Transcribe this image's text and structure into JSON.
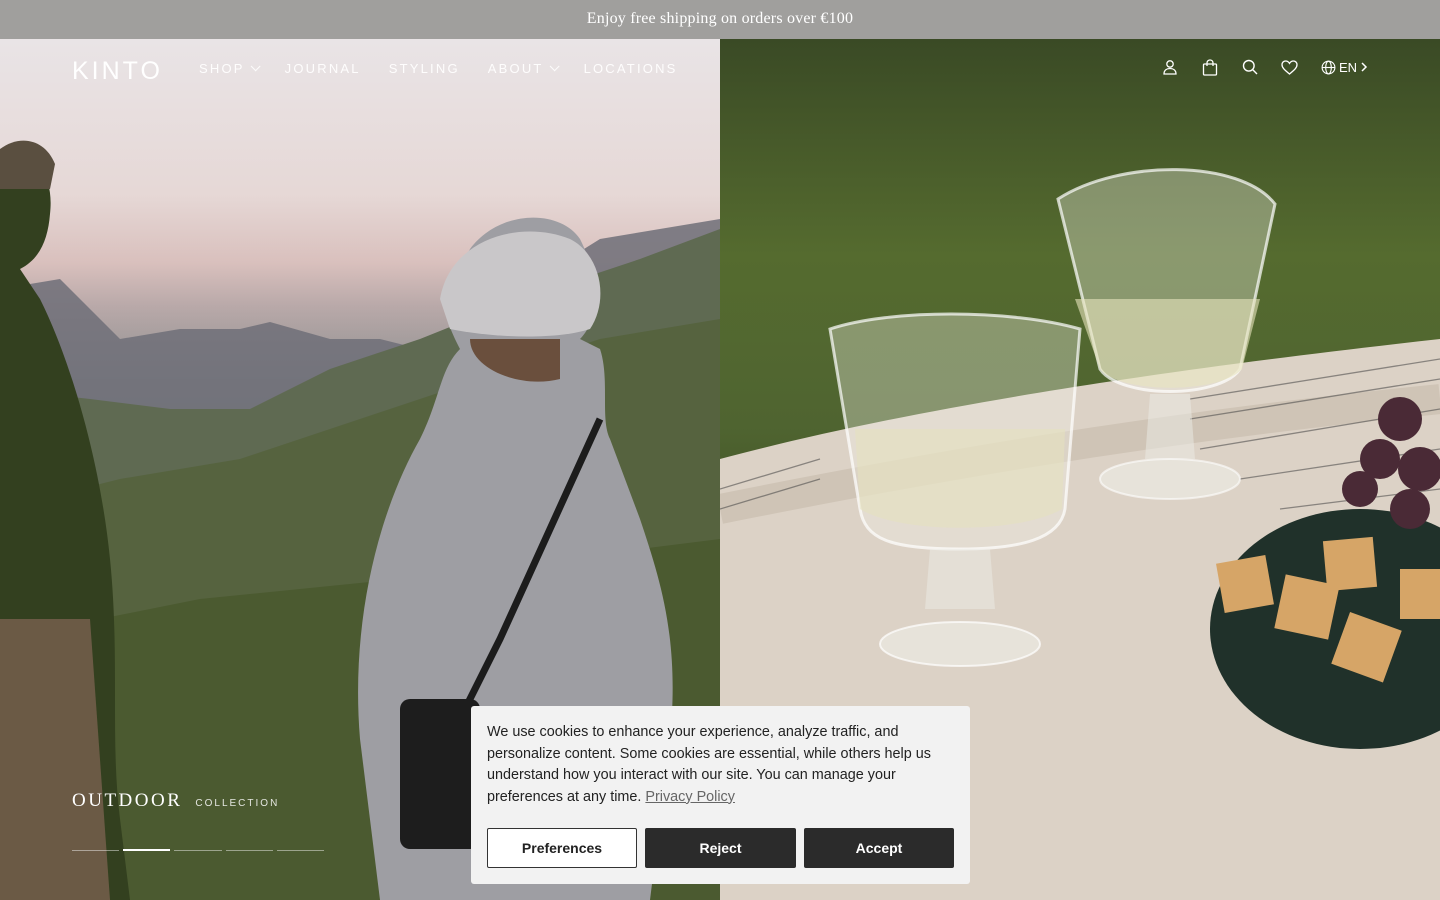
{
  "announcement": {
    "text": "Enjoy free shipping on orders over €100"
  },
  "header": {
    "logo": "KINTO",
    "menu": [
      {
        "label": "SHOP",
        "has_dropdown": true
      },
      {
        "label": "JOURNAL",
        "has_dropdown": false
      },
      {
        "label": "STYLING",
        "has_dropdown": false
      },
      {
        "label": "ABOUT",
        "has_dropdown": true
      },
      {
        "label": "LOCATIONS",
        "has_dropdown": false
      }
    ],
    "icons": [
      "account-icon",
      "bag-icon",
      "search-icon",
      "wishlist-icon",
      "globe-icon"
    ],
    "language": "EN"
  },
  "hero": {
    "collection_title": "OUTDOOR",
    "collection_subtitle": "COLLECTION",
    "slides_total": 5,
    "active_slide": 2
  },
  "cookie_banner": {
    "text": "We use cookies to enhance your experience, analyze traffic, and personalize content. Some cookies are essential, while others help us understand how you interact with our site. You can manage your preferences at any time.",
    "link_label": "Privacy Policy",
    "preferences_label": "Preferences",
    "reject_label": "Reject",
    "accept_label": "Accept"
  }
}
